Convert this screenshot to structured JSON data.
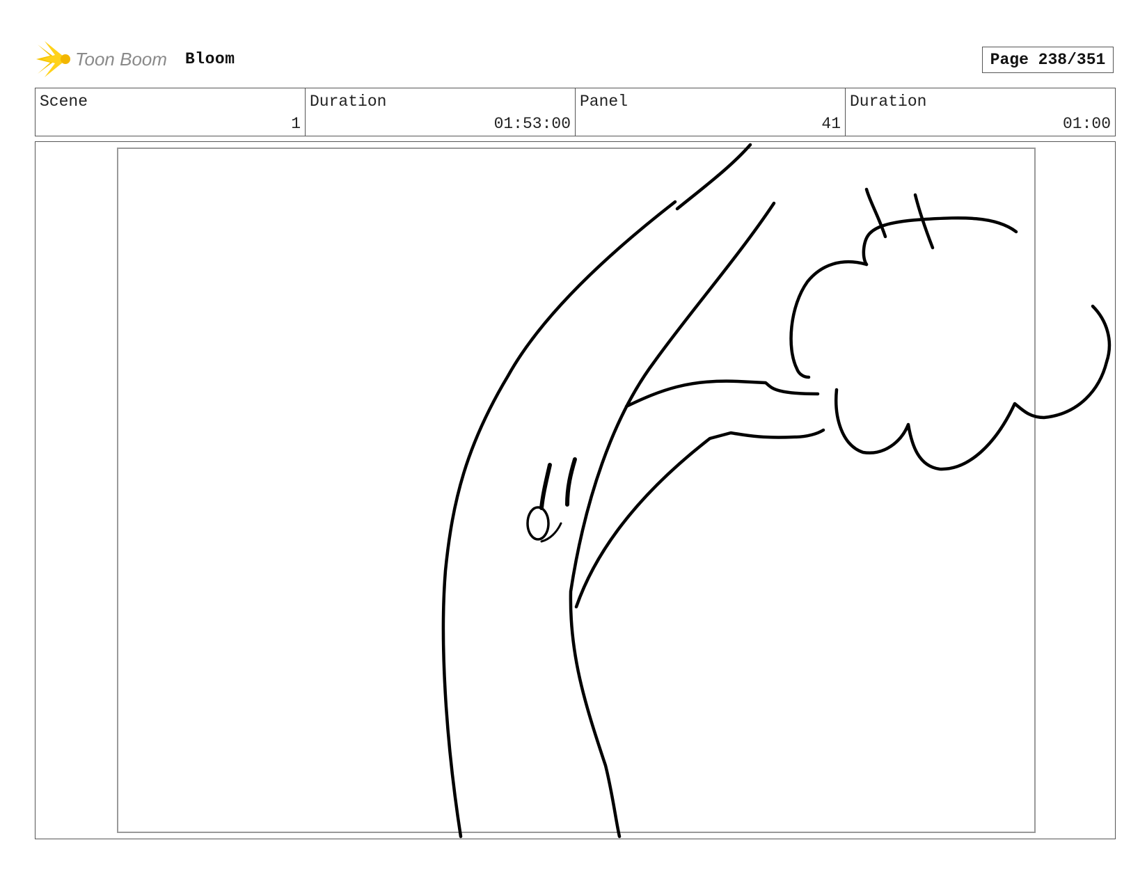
{
  "header": {
    "logo_text": "Toon Boom",
    "project_name": "Bloom",
    "page_label": "Page 238/351"
  },
  "info": {
    "scene_label": "Scene",
    "scene_value": "1",
    "scene_duration_label": "Duration",
    "scene_duration_value": "01:53:00",
    "panel_label": "Panel",
    "panel_value": "41",
    "panel_duration_label": "Duration",
    "panel_duration_value": "01:00"
  },
  "colors": {
    "logo_star": "#f5c400",
    "logo_text": "#8a8a8a",
    "border": "#555555",
    "safe_area": "#999999",
    "ink": "#000000"
  },
  "icons": [
    "toon-boom-star-icon"
  ]
}
